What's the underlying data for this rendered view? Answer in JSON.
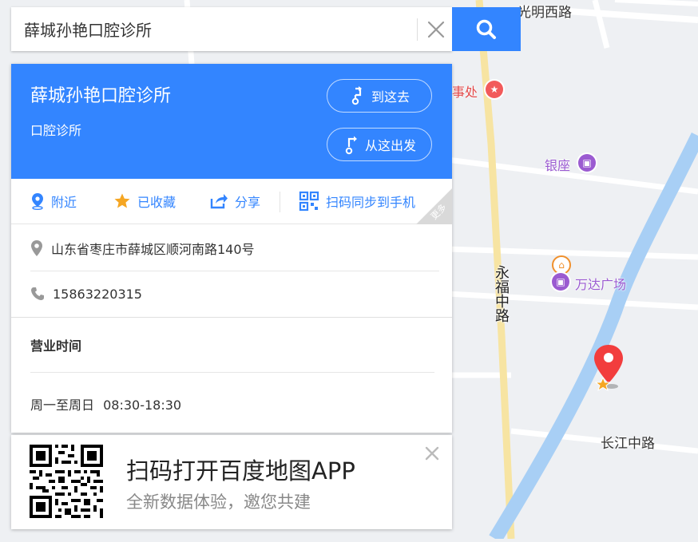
{
  "search": {
    "value": "薛城孙艳口腔诊所",
    "placeholder": ""
  },
  "place": {
    "name": "薛城孙艳口腔诊所",
    "category": "口腔诊所",
    "route_to_label": "到这去",
    "route_from_label": "从这出发"
  },
  "actions": {
    "nearby": "附近",
    "favorited": "已收藏",
    "share": "分享",
    "sync": "扫码同步到手机",
    "more": "更多"
  },
  "details": {
    "address": "山东省枣庄市薛城区顺河南路140号",
    "phone": "15863220315",
    "hours_title": "营业时间",
    "hours_days": "周一至周日",
    "hours_time": "08:30-18:30"
  },
  "promo": {
    "title": "扫码打开百度地图APP",
    "subtitle": "全新数据体验，邀您共建"
  },
  "map": {
    "roads": {
      "guangming": "光明西路",
      "yongfu": "永福中路",
      "changjiang": "长江中路"
    },
    "pois": {
      "office": "事处",
      "yinzuo": "银座",
      "wanda": "万达广场"
    }
  },
  "colors": {
    "accent": "#3385ff",
    "river": "#a8cff5",
    "road_major": "#f7e4a2",
    "marker": "#f23d3d",
    "poi_purple": "#9b5bd1"
  }
}
